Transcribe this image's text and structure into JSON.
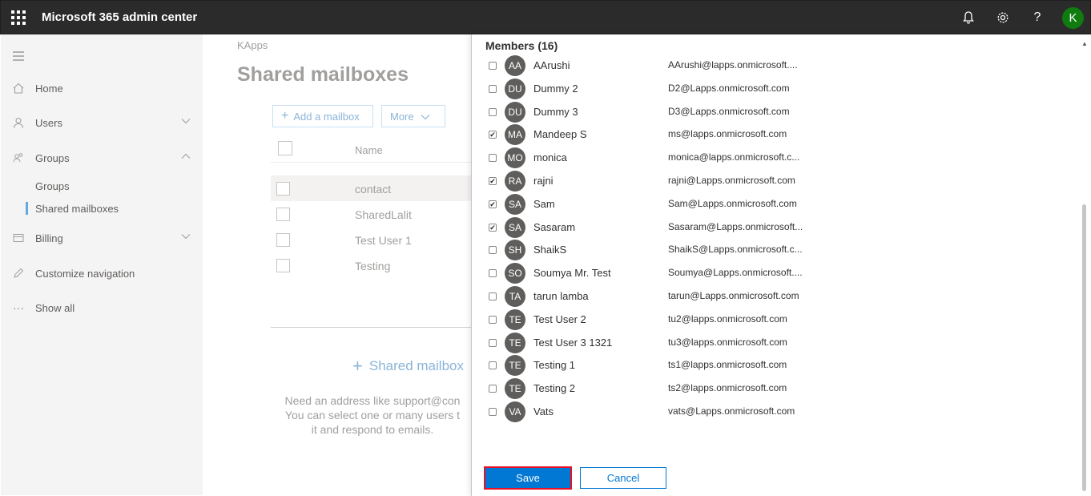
{
  "topbar": {
    "title": "Microsoft 365 admin center",
    "avatar_initial": "K",
    "icons": [
      "waffle-icon",
      "bell-icon",
      "gear-icon",
      "help-icon"
    ]
  },
  "nav": {
    "items": [
      {
        "label": "Home",
        "icon": "home-icon"
      },
      {
        "label": "Users",
        "icon": "user-icon"
      },
      {
        "label": "Groups",
        "icon": "groups-icon"
      },
      {
        "label": "Billing",
        "icon": "billing-icon"
      },
      {
        "label": "Customize navigation",
        "icon": "pencil-icon"
      },
      {
        "label": "Show all",
        "icon": "more-icon"
      }
    ],
    "sub_items": [
      "Groups",
      "Shared mailboxes"
    ]
  },
  "main": {
    "breadcrumb": "KApps",
    "title": "Shared mailboxes",
    "add_button": "Add a mailbox",
    "more_button": "More",
    "column_name": "Name",
    "rows": [
      "contact",
      "SharedLalit",
      "Test User 1",
      "Testing"
    ],
    "add_shared": "Shared mailbox",
    "help_lines": [
      "Need an address like support@con",
      "You can select one or many users t",
      "it and respond to emails."
    ]
  },
  "panel": {
    "members_title": "Members (16)",
    "members": [
      {
        "initials": "AA",
        "name": "AArushi",
        "email": "AArushi@lapps.onmicrosoft....",
        "checked": false
      },
      {
        "initials": "DU",
        "name": "Dummy 2",
        "email": "D2@Lapps.onmicrosoft.com",
        "checked": false
      },
      {
        "initials": "DU",
        "name": "Dummy 3",
        "email": "D3@Lapps.onmicrosoft.com",
        "checked": false
      },
      {
        "initials": "MA",
        "name": "Mandeep S",
        "email": "ms@lapps.onmicrosoft.com",
        "checked": true
      },
      {
        "initials": "MO",
        "name": "monica",
        "email": "monica@lapps.onmicrosoft.c...",
        "checked": false
      },
      {
        "initials": "RA",
        "name": "rajni",
        "email": "rajni@Lapps.onmicrosoft.com",
        "checked": true
      },
      {
        "initials": "SA",
        "name": "Sam",
        "email": "Sam@Lapps.onmicrosoft.com",
        "checked": true
      },
      {
        "initials": "SA",
        "name": "Sasaram",
        "email": "Sasaram@Lapps.onmicrosoft...",
        "checked": true
      },
      {
        "initials": "SH",
        "name": "ShaikS",
        "email": "ShaikS@Lapps.onmicrosoft.c...",
        "checked": false
      },
      {
        "initials": "SO",
        "name": "Soumya Mr. Test",
        "email": "Soumya@Lapps.onmicrosoft....",
        "checked": false
      },
      {
        "initials": "TA",
        "name": "tarun lamba",
        "email": "tarun@Lapps.onmicrosoft.com",
        "checked": false
      },
      {
        "initials": "TE",
        "name": "Test User 2",
        "email": "tu2@lapps.onmicrosoft.com",
        "checked": false
      },
      {
        "initials": "TE",
        "name": "Test User 3 1321",
        "email": "tu3@lapps.onmicrosoft.com",
        "checked": false
      },
      {
        "initials": "TE",
        "name": "Testing 1",
        "email": "ts1@lapps.onmicrosoft.com",
        "checked": false
      },
      {
        "initials": "TE",
        "name": "Testing 2",
        "email": "ts2@lapps.onmicrosoft.com",
        "checked": false
      },
      {
        "initials": "VA",
        "name": "Vats",
        "email": "vats@Lapps.onmicrosoft.com",
        "checked": false
      }
    ],
    "save_label": "Save",
    "cancel_label": "Cancel"
  },
  "colors": {
    "accent": "#0078d4",
    "topbar": "#2b2b2b",
    "highlight": "#e81123"
  }
}
